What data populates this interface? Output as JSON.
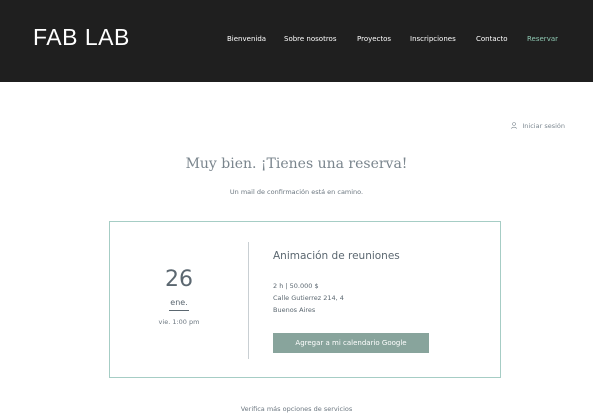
{
  "header": {
    "logo": "FAB LAB",
    "nav": [
      "Bienvenida",
      "Sobre nosotros",
      "Proyectos",
      "Inscripciones",
      "Contacto",
      "Reservar"
    ],
    "active_color": "#8fc9b3",
    "background": "#1f1f1f"
  },
  "login": {
    "label": "Iniciar sesión",
    "icon": "person-icon"
  },
  "confirmation": {
    "title": "Muy bien. ¡Tienes una reserva!",
    "subtitle": "Un mail de confirmación está en camino."
  },
  "booking": {
    "day": "26",
    "month": "ene.",
    "weekday_time": "vie. 1:00 pm",
    "service": "Animación de reuniones",
    "duration_price": "2 h | 50.000 $",
    "address_line1": "Calle Gutierrez 214, 4",
    "address_line2": "Buenos Aires",
    "calendar_button": "Agregar a mi calendario Google",
    "border_color": "#a6cdc5",
    "button_color": "#88a49c"
  },
  "footer_link": "Verifica más opciones de servicios"
}
